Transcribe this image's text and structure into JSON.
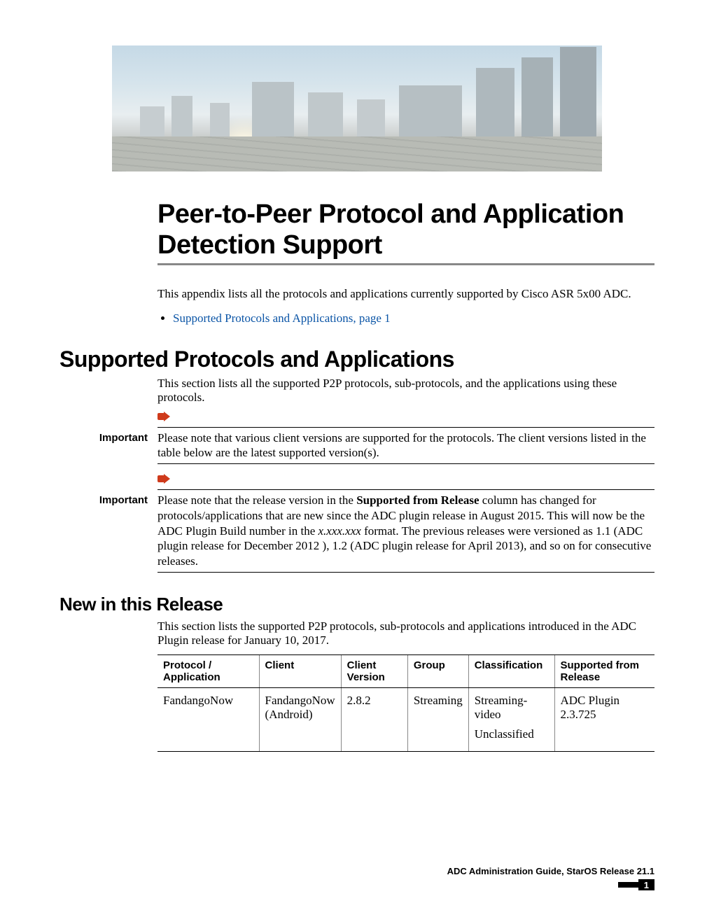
{
  "banner": {
    "alt": "cityscape header image"
  },
  "title": "Peer-to-Peer Protocol and Application Detection Support",
  "intro": "This appendix lists all the protocols and applications currently supported by Cisco ASR 5x00 ADC.",
  "toc_link": "Supported Protocols and Applications,  page  1",
  "section_heading": "Supported Protocols and Applications",
  "section_intro": "This section lists all the supported P2P protocols, sub-protocols, and the applications using these protocols.",
  "important_label": "Important",
  "note1": "Please note that various client versions are supported for the protocols. The client versions listed in the table below are the latest supported version(s).",
  "note2_pre": "Please note that the release version in the ",
  "note2_bold": "Supported from Release",
  "note2_mid": " column has changed for protocols/applications that are new since the ADC plugin release in August 2015. This will now be the ADC Plugin Build number in the ",
  "note2_italic": "x.xxx.xxx",
  "note2_post": " format. The previous releases were versioned as 1.1 (ADC plugin release for December 2012 ), 1.2 (ADC plugin release for April 2013), and so on for consecutive releases.",
  "subsection_heading": "New in this Release",
  "subsection_intro": "This section lists the supported P2P protocols, sub-protocols and applications introduced in the ADC Plugin release for January 10, 2017.",
  "table": {
    "headers": {
      "proto": "Protocol / Application",
      "client": "Client",
      "version": "Client Version",
      "group": "Group",
      "classification": "Classification",
      "release": "Supported from Release"
    },
    "row": {
      "proto": "FandangoNow",
      "client_line1": "FandangoNow",
      "client_line2": "(Android)",
      "version": "2.8.2",
      "group": "Streaming",
      "cls1": "Streaming-video",
      "cls2": "Unclassified",
      "release": "ADC Plugin 2.3.725"
    }
  },
  "footer": {
    "doc": "ADC Administration Guide, StarOS Release 21.1",
    "draft": "",
    "page": "1"
  }
}
